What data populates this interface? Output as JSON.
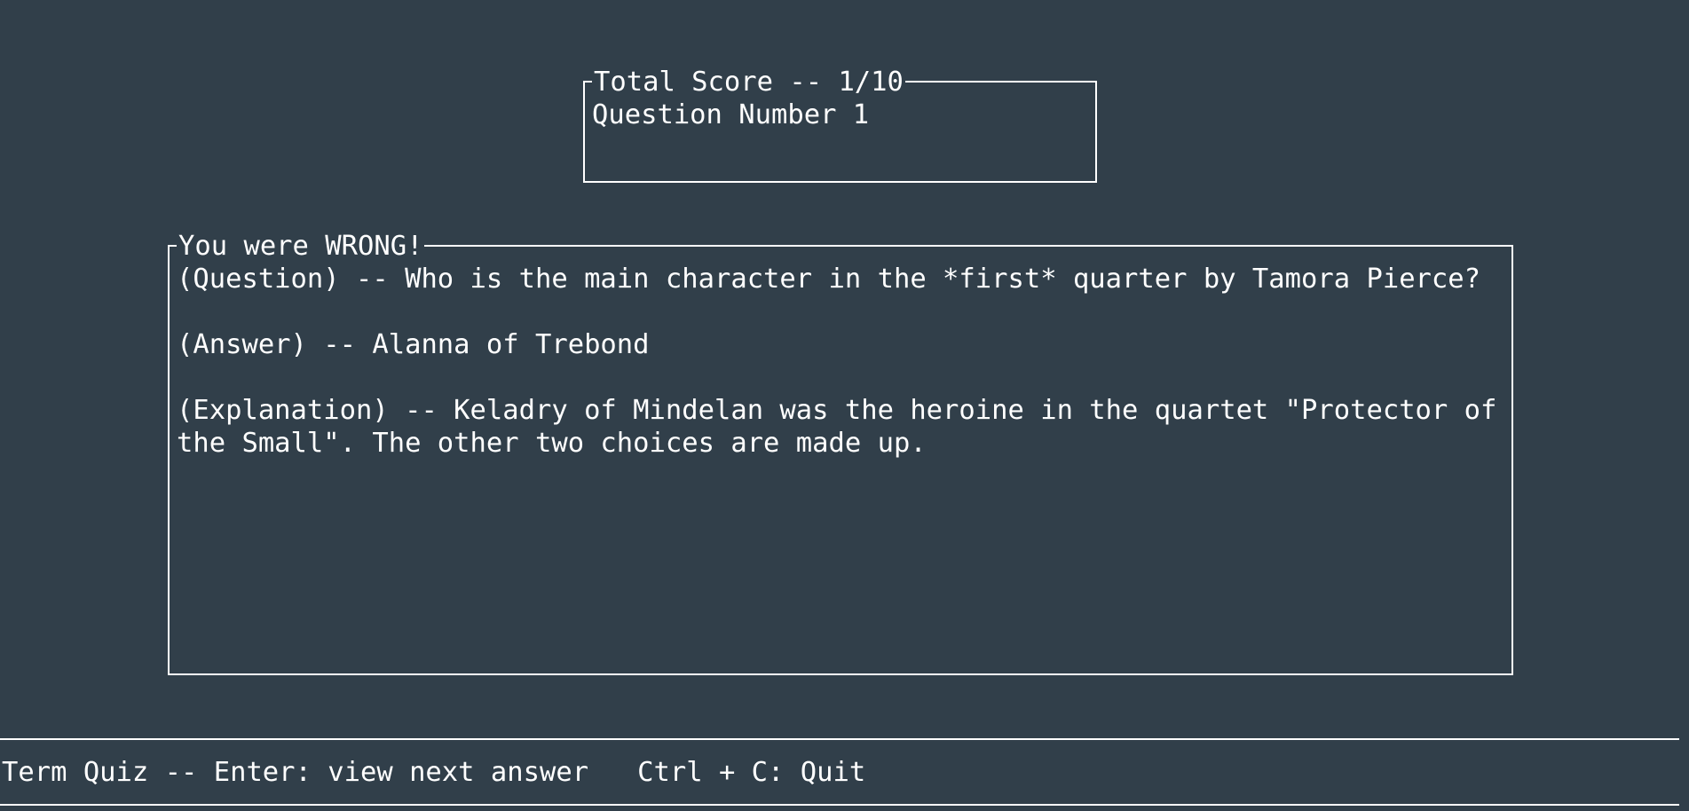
{
  "score_panel": {
    "title": "Total Score -- 1/10",
    "question_number": "Question Number 1"
  },
  "result_panel": {
    "title": "You were WRONG!",
    "question": "(Question) -- Who is the main character in the *first* quarter by Tamora Pierce?",
    "answer": "(Answer) -- Alanna of Trebond",
    "explanation_line1": "(Explanation) -- Keladry of Mindelan was the heroine in the quartet \"Protector of",
    "explanation_line2": "the Small\". The other two choices are made up."
  },
  "status_bar": {
    "text": "Term Quiz -- Enter: view next answer   Ctrl + C: Quit"
  }
}
